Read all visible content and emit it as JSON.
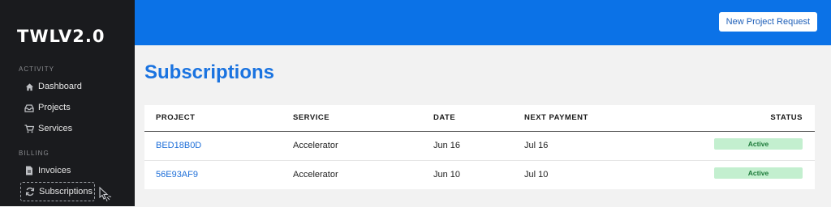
{
  "brand": {
    "logo_text": "TWLV2.0"
  },
  "sidebar": {
    "sections": [
      {
        "label": "ACTIVITY"
      },
      {
        "label": "BILLING"
      }
    ],
    "items": [
      {
        "label": "Dashboard",
        "icon": "home-icon"
      },
      {
        "label": "Projects",
        "icon": "inbox-tray-icon"
      },
      {
        "label": "Services",
        "icon": "cart-icon"
      },
      {
        "label": "Invoices",
        "icon": "document-icon"
      },
      {
        "label": "Subscriptions",
        "icon": "refresh-icon",
        "selected": true
      }
    ]
  },
  "header": {
    "button_label": "New Project Request"
  },
  "main": {
    "title": "Subscriptions",
    "table": {
      "columns": [
        "PROJECT",
        "SERVICE",
        "DATE",
        "NEXT PAYMENT",
        "STATUS"
      ],
      "rows": [
        {
          "project": "BED18B0D",
          "service": "Accelerator",
          "date": "Jun 16",
          "next_payment": "Jul 16",
          "status": "Active"
        },
        {
          "project": "56E93AF9",
          "service": "Accelerator",
          "date": "Jun 10",
          "next_payment": "Jul 10",
          "status": "Active"
        }
      ]
    }
  },
  "colors": {
    "accent": "#0b72e7",
    "sidebar_bg": "#1a1b1e",
    "status_active_bg": "#c3efcf",
    "status_active_text": "#1d7a3a"
  }
}
